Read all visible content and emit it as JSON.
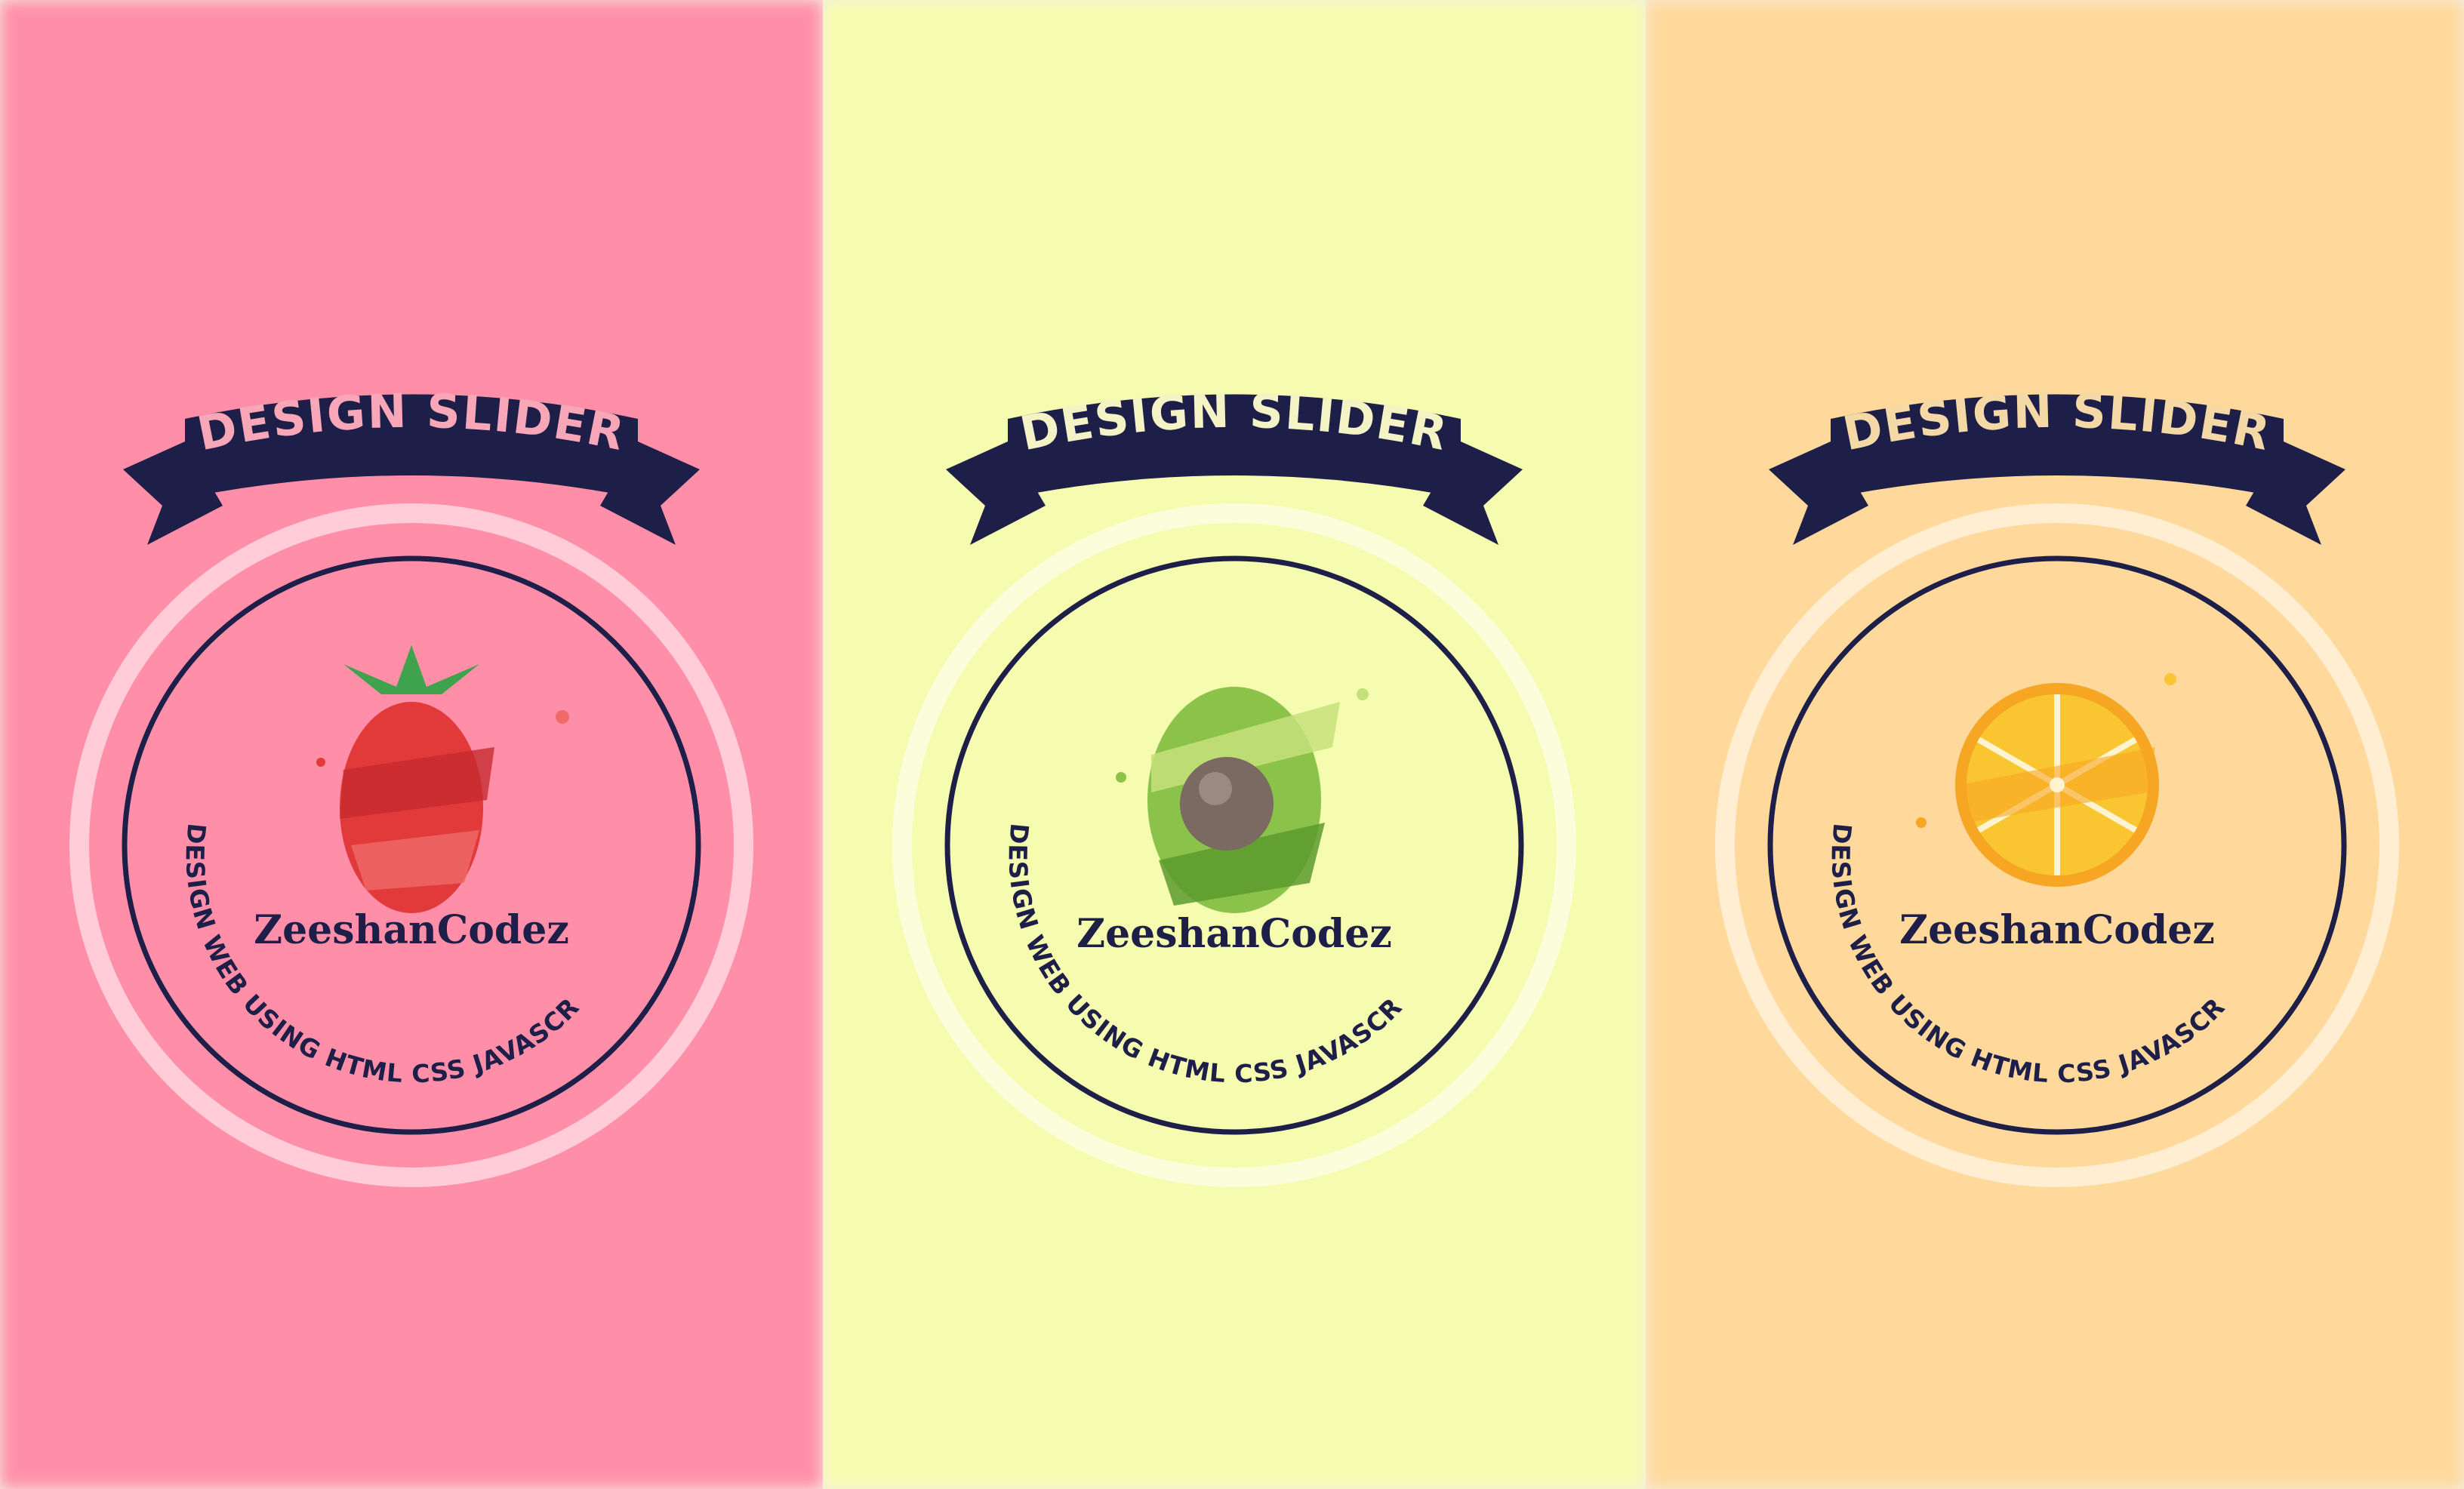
{
  "slides": [
    {
      "ribbon_title": "DESIGN SLIDER",
      "brand": "ZeeshanCodez",
      "curved_caption": "DESIGN WEB USING HTML CSS JAVASCRIPT",
      "fruit": "strawberry-icon",
      "bg_color": "#ff8fa8",
      "ribbon_text_color": "#f7a7b7"
    },
    {
      "ribbon_title": "DESIGN SLIDER",
      "brand": "ZeeshanCodez",
      "curved_caption": "DESIGN WEB USING HTML CSS JAVASCRIPT",
      "fruit": "avocado-icon",
      "bg_color": "#f5fcb0",
      "ribbon_text_color": "#f4f3c6"
    },
    {
      "ribbon_title": "DESIGN SLIDER",
      "brand": "ZeeshanCodez",
      "curved_caption": "DESIGN WEB USING HTML CSS JAVASCRIPT",
      "fruit": "orange-slice-icon",
      "bg_color": "#ffd99c",
      "ribbon_text_color": "#f4d9a6"
    }
  ],
  "colors": {
    "navy": "#1e1f48",
    "ring_light": "#ffffff"
  }
}
